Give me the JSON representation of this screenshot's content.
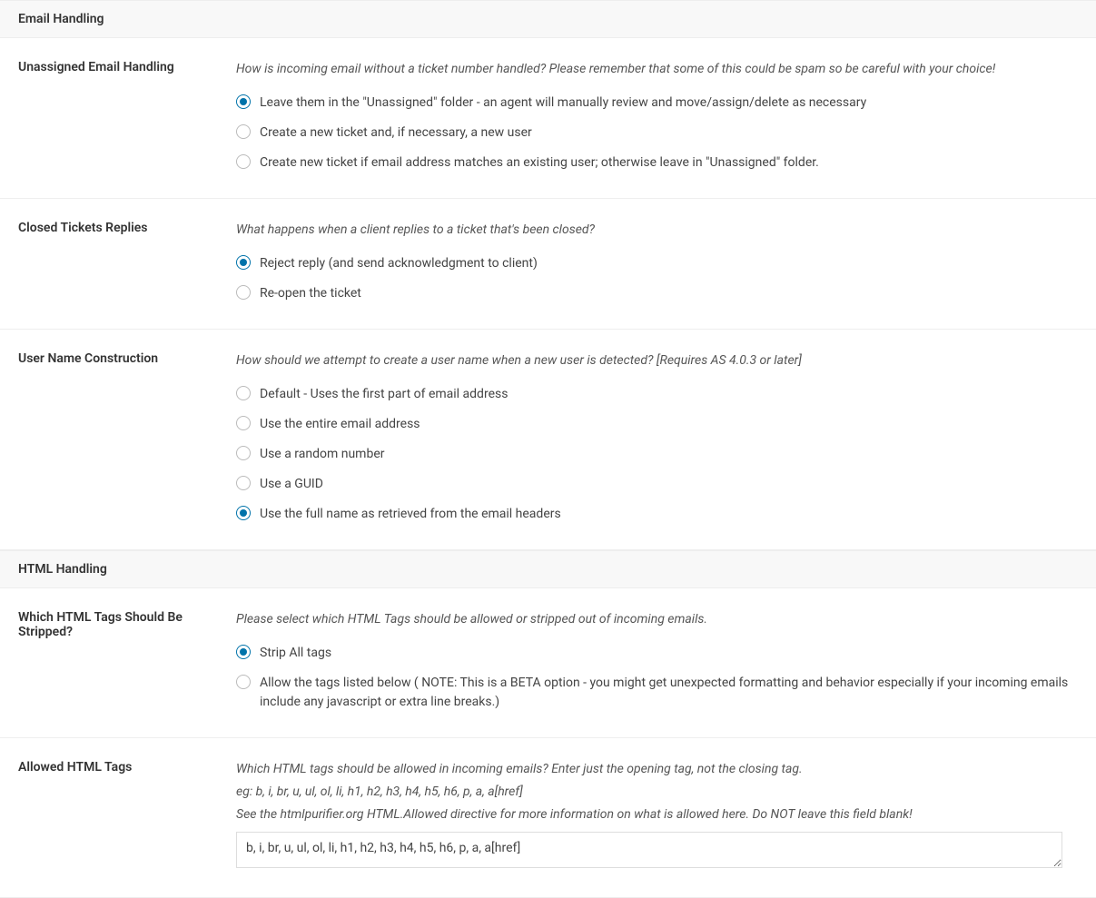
{
  "sections": {
    "email_handling": {
      "title": "Email Handling",
      "unassigned": {
        "label": "Unassigned Email Handling",
        "help": "How is incoming email without a ticket number handled? Please remember that some of this could be spam so be careful with your choice!",
        "selected_index": 0,
        "options": [
          "Leave them in the \"Unassigned\" folder - an agent will manually review and move/assign/delete as necessary",
          "Create a new ticket and, if necessary, a new user",
          "Create new ticket if email address matches an existing user; otherwise leave in \"Unassigned\" folder."
        ]
      },
      "closed_replies": {
        "label": "Closed Tickets Replies",
        "help": "What happens when a client replies to a ticket that's been closed?",
        "selected_index": 0,
        "options": [
          "Reject reply (and send acknowledgment to client)",
          "Re-open the ticket"
        ]
      },
      "username": {
        "label": "User Name Construction",
        "help": "How should we attempt to create a user name when a new user is detected? [Requires AS 4.0.3 or later]",
        "selected_index": 4,
        "options": [
          "Default - Uses the first part of email address",
          "Use the entire email address",
          "Use a random number",
          "Use a GUID",
          "Use the full name as retrieved from the email headers"
        ]
      }
    },
    "html_handling": {
      "title": "HTML Handling",
      "strip": {
        "label": "Which HTML Tags Should Be Stripped?",
        "help": "Please select which HTML Tags should be allowed or stripped out of incoming emails.",
        "selected_index": 0,
        "options": [
          "Strip All tags",
          "Allow the tags listed below ( NOTE: This is a BETA option - you might get unexpected formatting and behavior especially if your incoming emails include any javascript or extra line breaks.)"
        ]
      },
      "allowed": {
        "label": "Allowed HTML Tags",
        "help1": "Which HTML tags should be allowed in incoming emails? Enter just the opening tag, not the closing tag.",
        "help2": "eg: b, i, br, u, ul, ol, li, h1, h2, h3, h4, h5, h6, p, a, a[href]",
        "help3": "See the htmlpurifier.org HTML.Allowed directive for more information on what is allowed here. Do NOT leave this field blank!",
        "value": "b, i, br, u, ul, ol, li, h1, h2, h3, h4, h5, h6, p, a, a[href]"
      }
    }
  }
}
